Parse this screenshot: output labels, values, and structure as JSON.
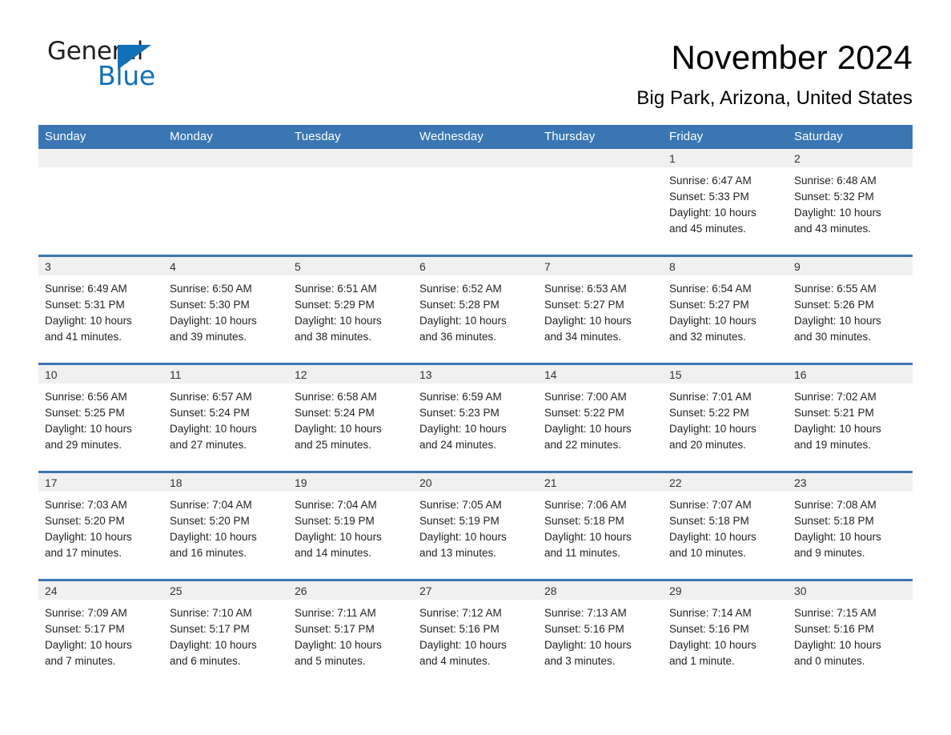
{
  "brand": {
    "name_part1": "General",
    "name_part2": "Blue",
    "triangle_icon": "brand-triangle-icon",
    "accent_color": "#1270b8"
  },
  "header": {
    "month_title": "November 2024",
    "location": "Big Park, Arizona, United States"
  },
  "theme": {
    "header_blue": "#3a76b3",
    "cell_head_gray": "#f0f0f0",
    "divider_blue": "#3a76b3"
  },
  "calendar": {
    "weekday_headers": [
      "Sunday",
      "Monday",
      "Tuesday",
      "Wednesday",
      "Thursday",
      "Friday",
      "Saturday"
    ],
    "weeks": [
      [
        {
          "day": "",
          "empty": true
        },
        {
          "day": "",
          "empty": true
        },
        {
          "day": "",
          "empty": true
        },
        {
          "day": "",
          "empty": true
        },
        {
          "day": "",
          "empty": true
        },
        {
          "day": "1",
          "sunrise": "Sunrise: 6:47 AM",
          "sunset": "Sunset: 5:33 PM",
          "daylight_line1": "Daylight: 10 hours",
          "daylight_line2": "and 45 minutes."
        },
        {
          "day": "2",
          "sunrise": "Sunrise: 6:48 AM",
          "sunset": "Sunset: 5:32 PM",
          "daylight_line1": "Daylight: 10 hours",
          "daylight_line2": "and 43 minutes."
        }
      ],
      [
        {
          "day": "3",
          "sunrise": "Sunrise: 6:49 AM",
          "sunset": "Sunset: 5:31 PM",
          "daylight_line1": "Daylight: 10 hours",
          "daylight_line2": "and 41 minutes."
        },
        {
          "day": "4",
          "sunrise": "Sunrise: 6:50 AM",
          "sunset": "Sunset: 5:30 PM",
          "daylight_line1": "Daylight: 10 hours",
          "daylight_line2": "and 39 minutes."
        },
        {
          "day": "5",
          "sunrise": "Sunrise: 6:51 AM",
          "sunset": "Sunset: 5:29 PM",
          "daylight_line1": "Daylight: 10 hours",
          "daylight_line2": "and 38 minutes."
        },
        {
          "day": "6",
          "sunrise": "Sunrise: 6:52 AM",
          "sunset": "Sunset: 5:28 PM",
          "daylight_line1": "Daylight: 10 hours",
          "daylight_line2": "and 36 minutes."
        },
        {
          "day": "7",
          "sunrise": "Sunrise: 6:53 AM",
          "sunset": "Sunset: 5:27 PM",
          "daylight_line1": "Daylight: 10 hours",
          "daylight_line2": "and 34 minutes."
        },
        {
          "day": "8",
          "sunrise": "Sunrise: 6:54 AM",
          "sunset": "Sunset: 5:27 PM",
          "daylight_line1": "Daylight: 10 hours",
          "daylight_line2": "and 32 minutes."
        },
        {
          "day": "9",
          "sunrise": "Sunrise: 6:55 AM",
          "sunset": "Sunset: 5:26 PM",
          "daylight_line1": "Daylight: 10 hours",
          "daylight_line2": "and 30 minutes."
        }
      ],
      [
        {
          "day": "10",
          "sunrise": "Sunrise: 6:56 AM",
          "sunset": "Sunset: 5:25 PM",
          "daylight_line1": "Daylight: 10 hours",
          "daylight_line2": "and 29 minutes."
        },
        {
          "day": "11",
          "sunrise": "Sunrise: 6:57 AM",
          "sunset": "Sunset: 5:24 PM",
          "daylight_line1": "Daylight: 10 hours",
          "daylight_line2": "and 27 minutes."
        },
        {
          "day": "12",
          "sunrise": "Sunrise: 6:58 AM",
          "sunset": "Sunset: 5:24 PM",
          "daylight_line1": "Daylight: 10 hours",
          "daylight_line2": "and 25 minutes."
        },
        {
          "day": "13",
          "sunrise": "Sunrise: 6:59 AM",
          "sunset": "Sunset: 5:23 PM",
          "daylight_line1": "Daylight: 10 hours",
          "daylight_line2": "and 24 minutes."
        },
        {
          "day": "14",
          "sunrise": "Sunrise: 7:00 AM",
          "sunset": "Sunset: 5:22 PM",
          "daylight_line1": "Daylight: 10 hours",
          "daylight_line2": "and 22 minutes."
        },
        {
          "day": "15",
          "sunrise": "Sunrise: 7:01 AM",
          "sunset": "Sunset: 5:22 PM",
          "daylight_line1": "Daylight: 10 hours",
          "daylight_line2": "and 20 minutes."
        },
        {
          "day": "16",
          "sunrise": "Sunrise: 7:02 AM",
          "sunset": "Sunset: 5:21 PM",
          "daylight_line1": "Daylight: 10 hours",
          "daylight_line2": "and 19 minutes."
        }
      ],
      [
        {
          "day": "17",
          "sunrise": "Sunrise: 7:03 AM",
          "sunset": "Sunset: 5:20 PM",
          "daylight_line1": "Daylight: 10 hours",
          "daylight_line2": "and 17 minutes."
        },
        {
          "day": "18",
          "sunrise": "Sunrise: 7:04 AM",
          "sunset": "Sunset: 5:20 PM",
          "daylight_line1": "Daylight: 10 hours",
          "daylight_line2": "and 16 minutes."
        },
        {
          "day": "19",
          "sunrise": "Sunrise: 7:04 AM",
          "sunset": "Sunset: 5:19 PM",
          "daylight_line1": "Daylight: 10 hours",
          "daylight_line2": "and 14 minutes."
        },
        {
          "day": "20",
          "sunrise": "Sunrise: 7:05 AM",
          "sunset": "Sunset: 5:19 PM",
          "daylight_line1": "Daylight: 10 hours",
          "daylight_line2": "and 13 minutes."
        },
        {
          "day": "21",
          "sunrise": "Sunrise: 7:06 AM",
          "sunset": "Sunset: 5:18 PM",
          "daylight_line1": "Daylight: 10 hours",
          "daylight_line2": "and 11 minutes."
        },
        {
          "day": "22",
          "sunrise": "Sunrise: 7:07 AM",
          "sunset": "Sunset: 5:18 PM",
          "daylight_line1": "Daylight: 10 hours",
          "daylight_line2": "and 10 minutes."
        },
        {
          "day": "23",
          "sunrise": "Sunrise: 7:08 AM",
          "sunset": "Sunset: 5:18 PM",
          "daylight_line1": "Daylight: 10 hours",
          "daylight_line2": "and 9 minutes."
        }
      ],
      [
        {
          "day": "24",
          "sunrise": "Sunrise: 7:09 AM",
          "sunset": "Sunset: 5:17 PM",
          "daylight_line1": "Daylight: 10 hours",
          "daylight_line2": "and 7 minutes."
        },
        {
          "day": "25",
          "sunrise": "Sunrise: 7:10 AM",
          "sunset": "Sunset: 5:17 PM",
          "daylight_line1": "Daylight: 10 hours",
          "daylight_line2": "and 6 minutes."
        },
        {
          "day": "26",
          "sunrise": "Sunrise: 7:11 AM",
          "sunset": "Sunset: 5:17 PM",
          "daylight_line1": "Daylight: 10 hours",
          "daylight_line2": "and 5 minutes."
        },
        {
          "day": "27",
          "sunrise": "Sunrise: 7:12 AM",
          "sunset": "Sunset: 5:16 PM",
          "daylight_line1": "Daylight: 10 hours",
          "daylight_line2": "and 4 minutes."
        },
        {
          "day": "28",
          "sunrise": "Sunrise: 7:13 AM",
          "sunset": "Sunset: 5:16 PM",
          "daylight_line1": "Daylight: 10 hours",
          "daylight_line2": "and 3 minutes."
        },
        {
          "day": "29",
          "sunrise": "Sunrise: 7:14 AM",
          "sunset": "Sunset: 5:16 PM",
          "daylight_line1": "Daylight: 10 hours",
          "daylight_line2": "and 1 minute."
        },
        {
          "day": "30",
          "sunrise": "Sunrise: 7:15 AM",
          "sunset": "Sunset: 5:16 PM",
          "daylight_line1": "Daylight: 10 hours",
          "daylight_line2": "and 0 minutes."
        }
      ]
    ]
  }
}
